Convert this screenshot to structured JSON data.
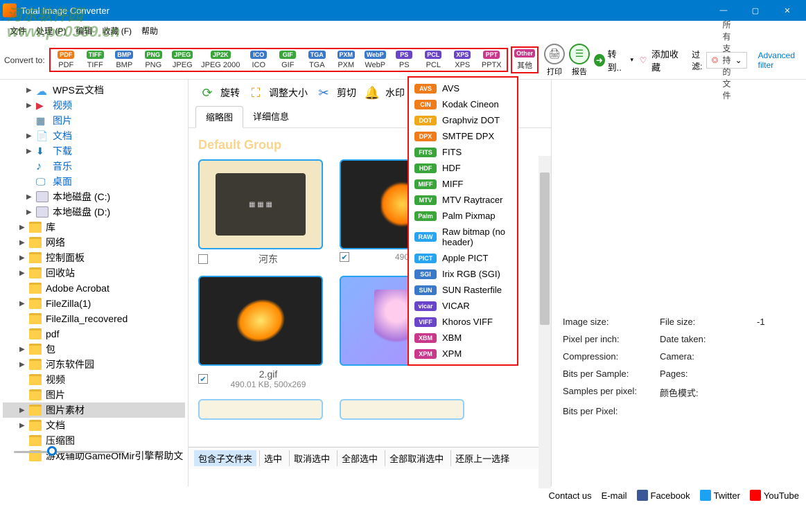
{
  "title": "Total Image Converter",
  "watermark": "河东软件园\nwww.pc0359.cn",
  "menu": [
    "文件",
    "处理 (P)",
    "编辑",
    "收藏 (F)",
    "帮助"
  ],
  "convert_label": "Convert to:",
  "formats": [
    {
      "badge": "PDF",
      "label": "PDF",
      "color": "#f07b1a"
    },
    {
      "badge": "TIFF",
      "label": "TIFF",
      "color": "#3aa53a"
    },
    {
      "badge": "BMP",
      "label": "BMP",
      "color": "#3a78c9"
    },
    {
      "badge": "PNG",
      "label": "PNG",
      "color": "#3aa53a"
    },
    {
      "badge": "JPEG",
      "label": "JPEG",
      "color": "#3aa53a"
    },
    {
      "badge": "JP2K",
      "label": "JPEG 2000",
      "color": "#3aa53a",
      "wide": true
    },
    {
      "badge": "ICO",
      "label": "ICO",
      "color": "#3a78c9"
    },
    {
      "badge": "GIF",
      "label": "GIF",
      "color": "#3aa53a"
    },
    {
      "badge": "TGA",
      "label": "TGA",
      "color": "#3a78c9"
    },
    {
      "badge": "PXM",
      "label": "PXM",
      "color": "#3a78c9"
    },
    {
      "badge": "WebP",
      "label": "WebP",
      "color": "#3a78c9"
    },
    {
      "badge": "PS",
      "label": "PS",
      "color": "#6a45c9"
    },
    {
      "badge": "PCL",
      "label": "PCL",
      "color": "#6a45c9"
    },
    {
      "badge": "XPS",
      "label": "XPS",
      "color": "#6a45c9"
    },
    {
      "badge": "PPT",
      "label": "PPTX",
      "color": "#c9388a"
    }
  ],
  "other_btn": {
    "badge": "Other",
    "label": "其他"
  },
  "buttons": {
    "print": "打印",
    "report": "报告",
    "goto": "转到..",
    "fav": "添加收藏"
  },
  "filter_label": "过滤:",
  "filter_value": "所有支持的文件",
  "advanced_filter": "Advanced filter",
  "tools": {
    "rotate": "旋转",
    "resize": "调整大小",
    "crop": "剪切",
    "watermark": "水印"
  },
  "tabs": [
    "缩略图",
    "详细信息"
  ],
  "group_title": "Default Group",
  "thumbs": [
    {
      "name": "河东",
      "meta": "",
      "checked": false,
      "kind": "folder"
    },
    {
      "name": "",
      "meta": "490.0…",
      "checked": true,
      "kind": "flame"
    },
    {
      "name": "2.gif",
      "meta": "490.01 KB, 500x269",
      "checked": true,
      "kind": "butterfly"
    },
    {
      "name": "",
      "meta": "",
      "checked": false,
      "kind": "anime"
    }
  ],
  "dropdown": [
    {
      "b": "AVS",
      "t": "AVS",
      "c": "#f07b1a"
    },
    {
      "b": "CIN",
      "t": "Kodak Cineon",
      "c": "#f07b1a"
    },
    {
      "b": "DOT",
      "t": "Graphviz DOT",
      "c": "#f0a81a"
    },
    {
      "b": "DPX",
      "t": "SMTPE DPX",
      "c": "#f07b1a"
    },
    {
      "b": "FITS",
      "t": "FITS",
      "c": "#3aa53a"
    },
    {
      "b": "HDF",
      "t": "HDF",
      "c": "#3aa53a"
    },
    {
      "b": "MIFF",
      "t": "MIFF",
      "c": "#3aa53a"
    },
    {
      "b": "MTV",
      "t": "MTV Raytracer",
      "c": "#3aa53a"
    },
    {
      "b": "Palm",
      "t": "Palm Pixmap",
      "c": "#3aa53a"
    },
    {
      "b": "RAW",
      "t": "Raw bitmap (no header)",
      "c": "#27a3f0"
    },
    {
      "b": "PICT",
      "t": "Apple PICT",
      "c": "#27a3f0"
    },
    {
      "b": "SGI",
      "t": "Irix RGB (SGI)",
      "c": "#3a78c9"
    },
    {
      "b": "SUN",
      "t": "SUN Rasterfile",
      "c": "#3a78c9"
    },
    {
      "b": "vicar",
      "t": "VICAR",
      "c": "#6a45c9"
    },
    {
      "b": "VIFF",
      "t": "Khoros VIFF",
      "c": "#6a45c9"
    },
    {
      "b": "XBM",
      "t": "XBM",
      "c": "#c9388a"
    },
    {
      "b": "XPM",
      "t": "XPM",
      "c": "#c9388a"
    }
  ],
  "tree": [
    {
      "t": "WPS云文档",
      "icon": "cloud",
      "caret": "▶",
      "indent": 1
    },
    {
      "t": "视频",
      "icon": "vid",
      "caret": "▶",
      "indent": 1,
      "blue": true
    },
    {
      "t": "图片",
      "icon": "img",
      "caret": "",
      "indent": 1,
      "blue": true
    },
    {
      "t": "文档",
      "icon": "doc",
      "caret": "▶",
      "indent": 1,
      "blue": true
    },
    {
      "t": "下载",
      "icon": "down",
      "caret": "▶",
      "indent": 1,
      "blue": true
    },
    {
      "t": "音乐",
      "icon": "music",
      "caret": "",
      "indent": 1,
      "blue": true
    },
    {
      "t": "桌面",
      "icon": "desk",
      "caret": "",
      "indent": 1,
      "blue": true
    },
    {
      "t": "本地磁盘 (C:)",
      "icon": "drive",
      "caret": "▶",
      "indent": 1
    },
    {
      "t": "本地磁盘 (D:)",
      "icon": "drive",
      "caret": "▶",
      "indent": 1
    },
    {
      "t": "库",
      "icon": "folder",
      "caret": "▶",
      "indent": 0
    },
    {
      "t": "网络",
      "icon": "folder",
      "caret": "▶",
      "indent": 0
    },
    {
      "t": "控制面板",
      "icon": "folder",
      "caret": "▶",
      "indent": 0
    },
    {
      "t": "回收站",
      "icon": "folder",
      "caret": "▶",
      "indent": 0
    },
    {
      "t": "Adobe Acrobat",
      "icon": "folder",
      "caret": "",
      "indent": 0
    },
    {
      "t": "FileZilla(1)",
      "icon": "folder",
      "caret": "▶",
      "indent": 0
    },
    {
      "t": "FileZilla_recovered",
      "icon": "folder",
      "caret": "",
      "indent": 0
    },
    {
      "t": "pdf",
      "icon": "folder",
      "caret": "",
      "indent": 0
    },
    {
      "t": "包",
      "icon": "folder",
      "caret": "▶",
      "indent": 0
    },
    {
      "t": "河东软件园",
      "icon": "folder",
      "caret": "▶",
      "indent": 0
    },
    {
      "t": "视频",
      "icon": "folder",
      "caret": "",
      "indent": 0
    },
    {
      "t": "图片",
      "icon": "folder",
      "caret": "",
      "indent": 0
    },
    {
      "t": "图片素材",
      "icon": "folder",
      "caret": "▶",
      "indent": 0,
      "sel": true
    },
    {
      "t": "文档",
      "icon": "folder",
      "caret": "▶",
      "indent": 0
    },
    {
      "t": "压缩图",
      "icon": "folder",
      "caret": "",
      "indent": 0
    },
    {
      "t": "游戏辅助GameOfMir引擎帮助文",
      "icon": "folder",
      "caret": "",
      "indent": 0
    }
  ],
  "props": [
    {
      "k": "Image size:",
      "v": ""
    },
    {
      "k": "File size:",
      "v": "-1"
    },
    {
      "k": "Pixel per inch:",
      "v": ""
    },
    {
      "k": "Date taken:",
      "v": ""
    },
    {
      "k": "Compression:",
      "v": ""
    },
    {
      "k": "Camera:",
      "v": ""
    },
    {
      "k": "Bits per Sample:",
      "v": ""
    },
    {
      "k": "Pages:",
      "v": ""
    },
    {
      "k": "Samples per pixel:",
      "v": ""
    },
    {
      "k": "颜色模式:",
      "v": ""
    },
    {
      "k": "Bits per Pixel:",
      "v": ""
    }
  ],
  "bottom": [
    "包含子文件夹",
    "选中",
    "取消选中",
    "全部选中",
    "全部取消选中",
    "还原上一选择"
  ],
  "footer": {
    "contact": "Contact us",
    "email": "E-mail",
    "facebook": "Facebook",
    "twitter": "Twitter",
    "youtube": "YouTube"
  }
}
